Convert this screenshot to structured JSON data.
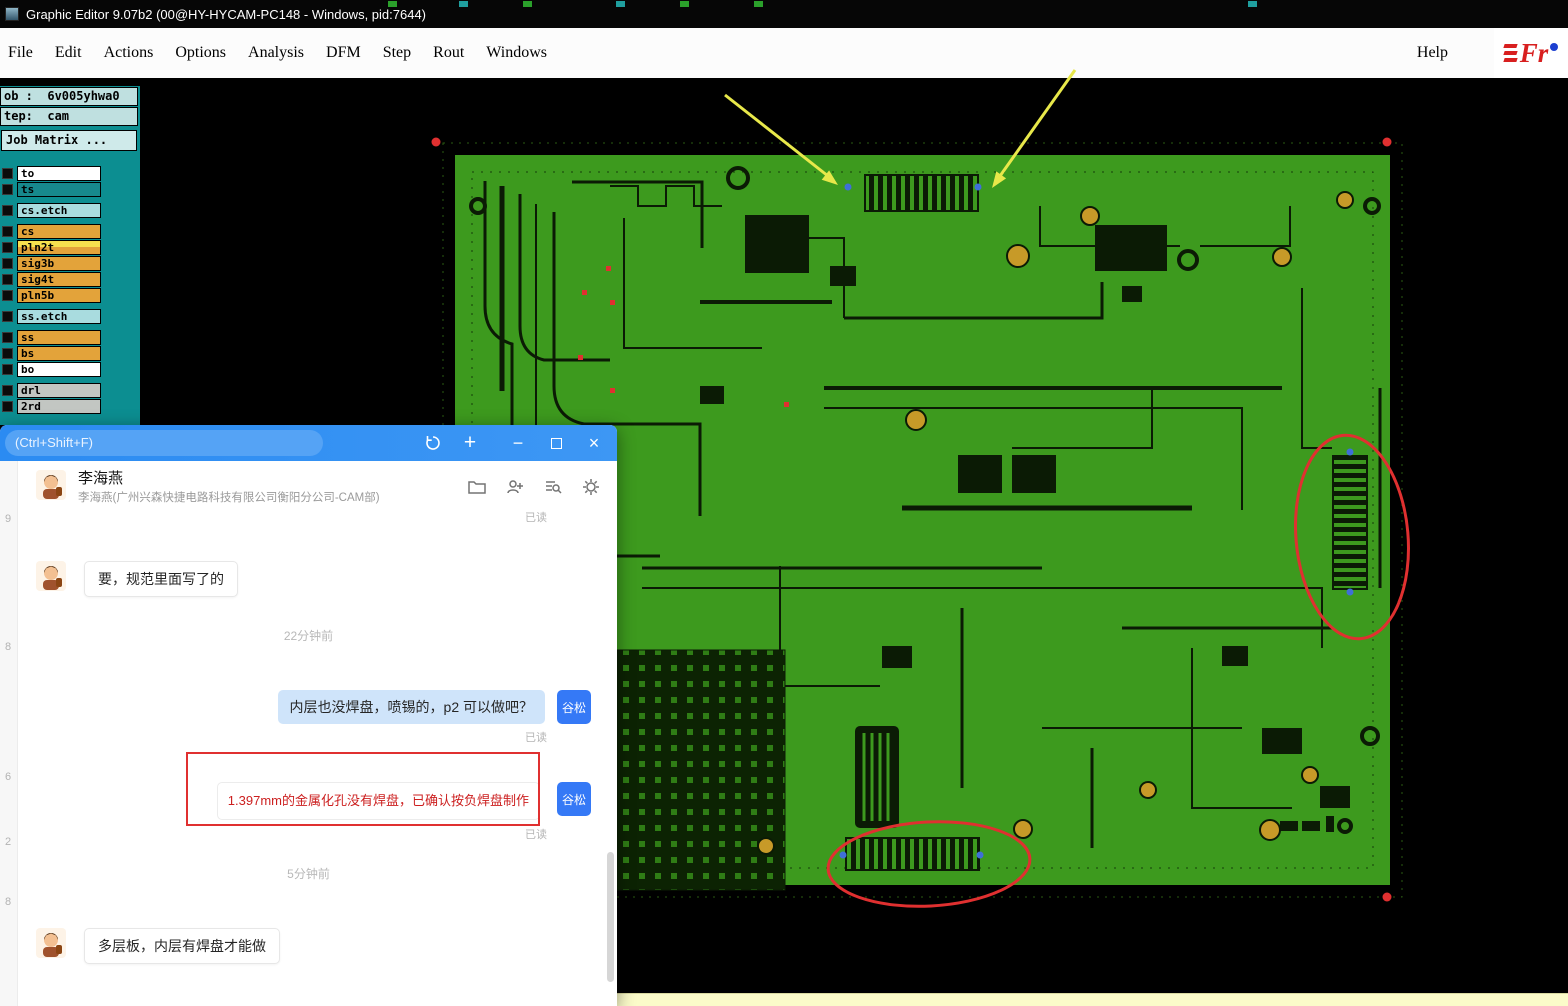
{
  "colors": {
    "board_green": "#3d9a1e",
    "trace_black": "#0b1b05",
    "pad_orange": "#c79a28",
    "annotation_red": "#e03030",
    "annotation_yellow": "#e8e84a",
    "panel_teal": "#0c8e91",
    "row_orange": "#e3a33a",
    "row_cyan": "#a9dcdf",
    "row_teal": "#17898d",
    "row_highlight_yellow": "#f6e14e",
    "chat_header_blue": "#2e8df3",
    "sent_bubble_blue": "#cfe4fa",
    "badge_blue": "#3579f6"
  },
  "titlebar": {
    "title": "Graphic Editor 9.07b2 (00@HY-HYCAM-PC148 - Windows, pid:7644)"
  },
  "menubar": {
    "items": [
      "File",
      "Edit",
      "Actions",
      "Options",
      "Analysis",
      "DFM",
      "Step",
      "Rout",
      "Windows"
    ],
    "help": "Help",
    "logo_text": "Fr"
  },
  "job_panel": {
    "job_label": "ob :  6v005yhwa0",
    "step_label": "tep:  cam",
    "matrix_button": "Job Matrix ..."
  },
  "matrix": {
    "rows": [
      {
        "name": "to",
        "color": "#ffffff"
      },
      {
        "name": "ts",
        "color": "#17898d"
      },
      {
        "name": "cs.etch",
        "color": "#a9dcdf"
      },
      {
        "name": "cs",
        "color": "#e3a33a"
      },
      {
        "name": "pln2t",
        "color": "#e3a33a"
      },
      {
        "name": "sig3b",
        "color": "#e3a33a"
      },
      {
        "name": "sig4t",
        "color": "#e3a33a"
      },
      {
        "name": "pln5b",
        "color": "#e3a33a"
      },
      {
        "name": "ss.etch",
        "color": "#a9dcdf"
      },
      {
        "name": "ss",
        "color": "#e3a33a"
      },
      {
        "name": "bs",
        "color": "#e3a33a"
      },
      {
        "name": "bo",
        "color": "#ffffff"
      },
      {
        "name": "drl",
        "color": "#c2c6c2"
      },
      {
        "name": "2rd",
        "color": "#c2c6c2"
      }
    ]
  },
  "chat": {
    "search_placeholder": "(Ctrl+Shift+F)",
    "window_controls": {
      "add": "+",
      "minimize": "−",
      "close": "×"
    },
    "contact": {
      "name": "李海燕",
      "description": "李海燕(广州兴森快捷电路科技有限公司衡阳分公司-CAM部)"
    },
    "read_label": "已读",
    "sender_badge": "谷松",
    "messages": [
      {
        "type": "received",
        "text": "要，规范里面写了的"
      },
      {
        "type": "timestamp",
        "text": "22分钟前"
      },
      {
        "type": "sent",
        "text": "内层也没焊盘，喷锡的，p2 可以做吧？",
        "status": "已读"
      },
      {
        "type": "sent",
        "text": "1.397mm的金属化孔没有焊盘，已确认按负焊盘制作",
        "status": "已读",
        "annotated": true
      },
      {
        "type": "timestamp",
        "text": "5分钟前"
      },
      {
        "type": "received",
        "text": "多层板，内层有焊盘才能做"
      }
    ],
    "gutter_marks": [
      "9",
      "8",
      "6",
      "2",
      "8"
    ]
  }
}
